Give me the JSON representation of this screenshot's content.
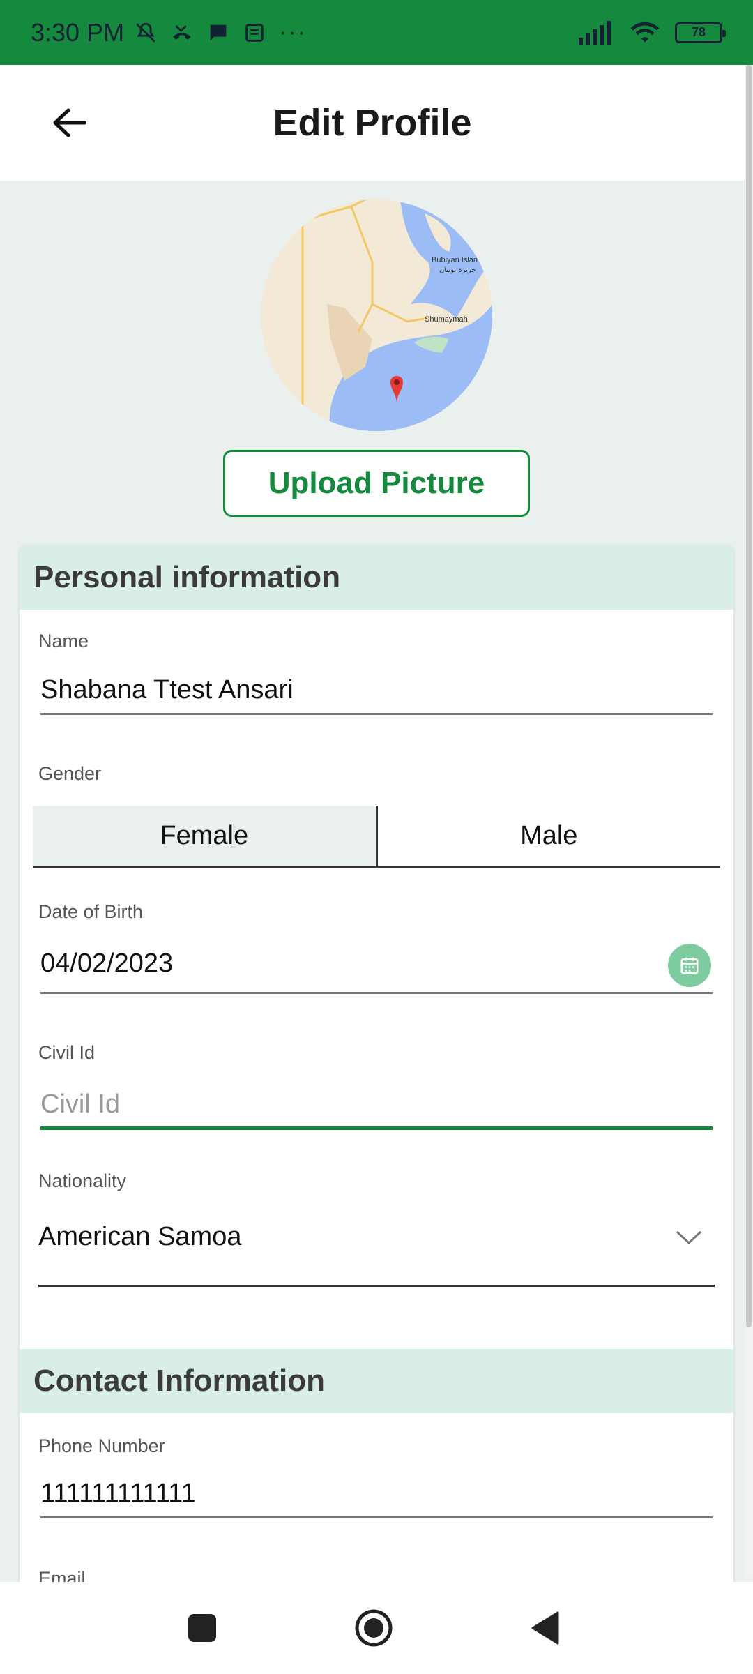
{
  "status_bar": {
    "time": "3:30 PM",
    "battery": "78"
  },
  "header": {
    "title": "Edit Profile"
  },
  "profile": {
    "upload_label": "Upload Picture",
    "map_labels": [
      "Bubiyan Islan",
      "جزيرة بوبيان",
      "Shumaymah"
    ]
  },
  "personal": {
    "title": "Personal information",
    "name_label": "Name",
    "name_value": "Shabana Ttest Ansari",
    "gender_label": "Gender",
    "gender_options": [
      "Female",
      "Male"
    ],
    "gender_selected": "Female",
    "dob_label": "Date of Birth",
    "dob_value": "04/02/2023",
    "civil_label": "Civil Id",
    "civil_placeholder": "Civil Id",
    "nationality_label": "Nationality",
    "nationality_value": "American Samoa"
  },
  "contact": {
    "title": "Contact Information",
    "phone_label": "Phone Number",
    "phone_value": "111111111111",
    "email_label": "Email"
  },
  "colors": {
    "brand": "#158a3e",
    "section_bg": "#d9eee4",
    "page_bg": "#e9f0ed"
  }
}
